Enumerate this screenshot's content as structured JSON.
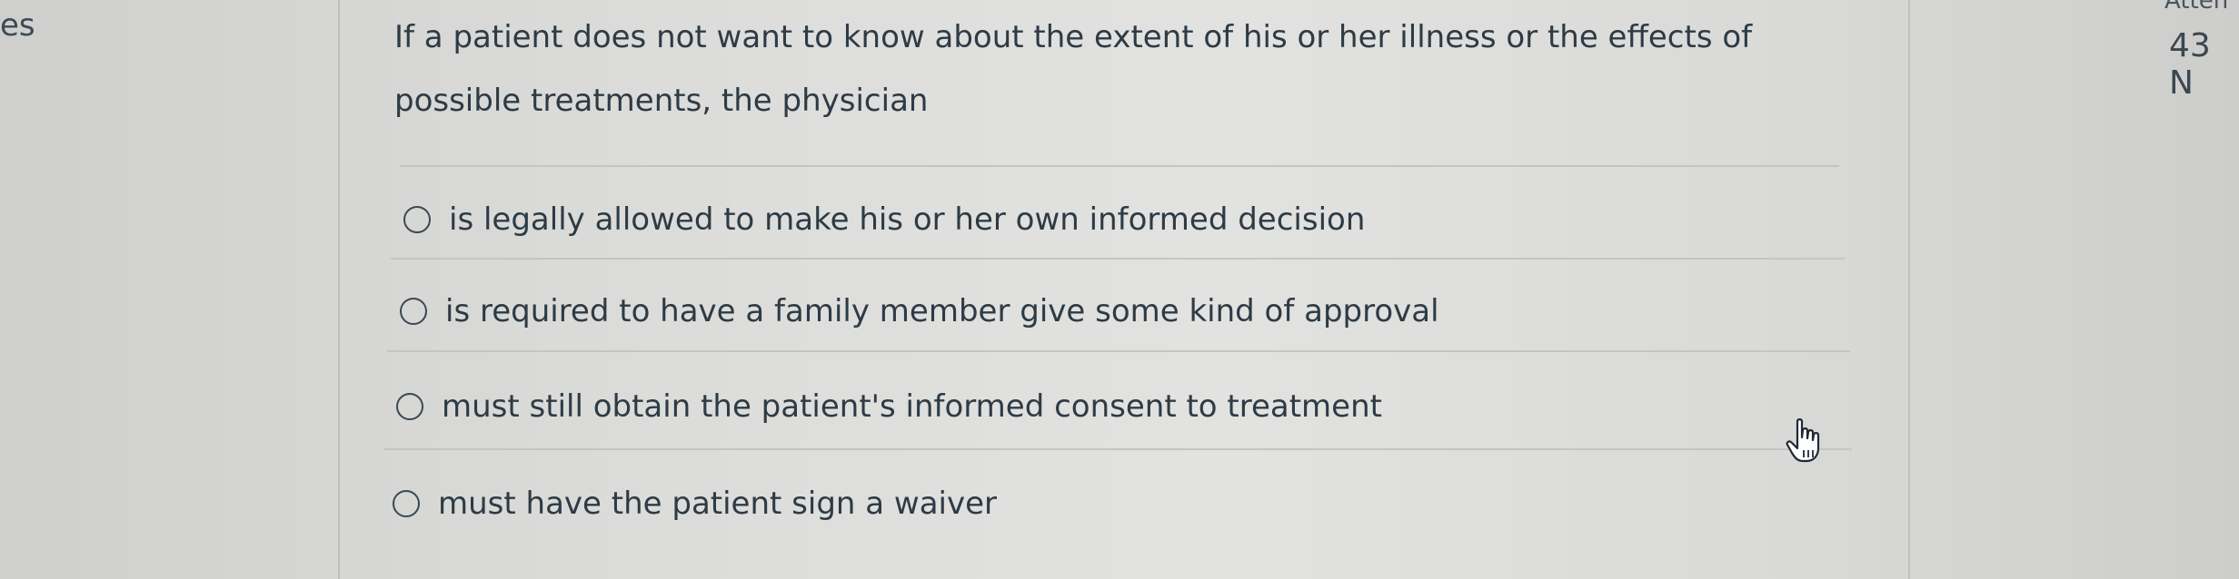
{
  "side_fragments": {
    "left": "es",
    "right_top": "Atten",
    "right": "43 N"
  },
  "question": {
    "text": "If a patient does not want to know about the extent of his or her illness or the effects of possible treatments, the physician"
  },
  "answers": [
    {
      "label": "is legally allowed to make his or her own informed decision",
      "selected": false
    },
    {
      "label": "is required to have a family member give some kind of approval",
      "selected": false
    },
    {
      "label": "must still obtain the patient's informed consent to treatment",
      "selected": false
    },
    {
      "label": "must have the patient sign a waiver",
      "selected": false
    }
  ],
  "cursor": {
    "icon": "hand-pointer-icon"
  }
}
